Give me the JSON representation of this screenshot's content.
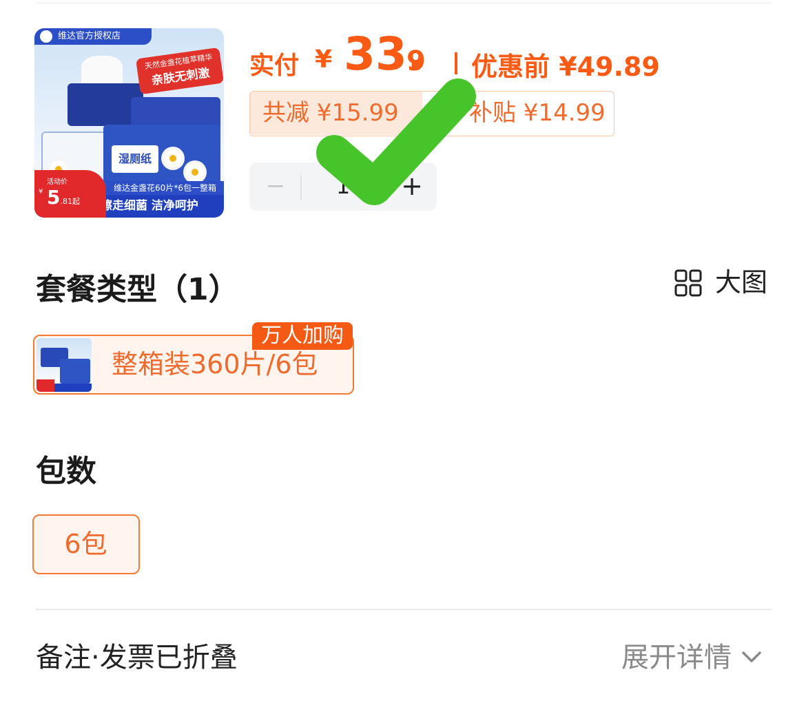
{
  "product": {
    "shop_badge": "维达官方授权店",
    "slogan_top": "天然金盏花植萃精华",
    "slogan_main": "亲肤无刺激",
    "wipe_label": "湿厕纸",
    "caption": "维达金盏花60片*6包一整箱",
    "tagline": "擦走细菌 洁净呵护",
    "promo_label": "活动价",
    "promo_yen": "¥",
    "promo_value": "5",
    "promo_cents": ".81",
    "promo_qualifier": "起"
  },
  "price": {
    "paid_label": "实付",
    "currency": "¥",
    "paid_integer": "33.",
    "paid_decimal": "9",
    "before_label": "优惠前 ¥49.89",
    "total_reduction": "共减 ¥15.99",
    "subsidy": "补贴 ¥14.99"
  },
  "quantity": {
    "minus": "−",
    "value": "1",
    "plus": "+"
  },
  "package_type": {
    "title": "套餐类型（1）",
    "big_view_label": "大图",
    "options": [
      {
        "label": "整箱装360片/6包",
        "badge": "万人加购"
      }
    ]
  },
  "pack_count": {
    "title": "包数",
    "options": [
      {
        "label": "6包"
      }
    ]
  },
  "footer": {
    "notes_label": "备注·发票已折叠",
    "expand_label": "展开详情"
  },
  "colors": {
    "accent": "#fa5b14",
    "selected_border": "#f37a32",
    "selected_bg": "#fff5ee",
    "checkmark": "#46c42a"
  },
  "icons": {
    "big_view": "grid-icon",
    "expand": "chevron-down-icon",
    "overlay": "checkmark-icon"
  }
}
